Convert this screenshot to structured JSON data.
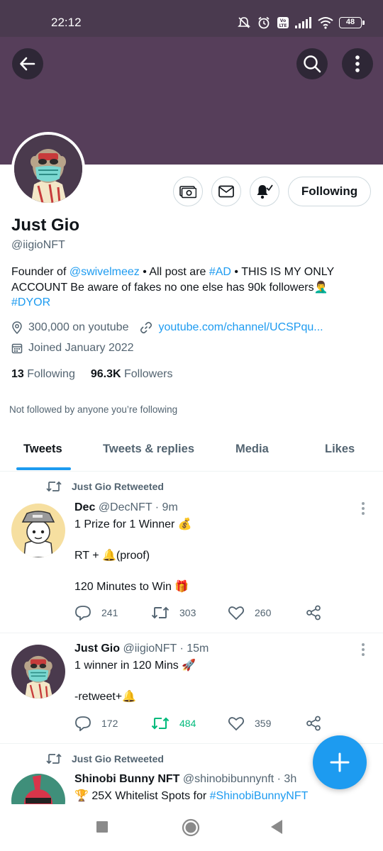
{
  "status": {
    "time": "22:12",
    "battery": "48",
    "net": "Vo LTE"
  },
  "profile": {
    "name": "Just Gio",
    "handle": "@iigioNFT",
    "following_button": "Following",
    "bio": {
      "p1": "Founder of ",
      "mention": "@swivelmeez",
      "p2": " • All post are ",
      "hashtag1": "#AD",
      "p3": " • THIS IS MY ONLY ACCOUNT Be aware of fakes no one else has 90k followers",
      "emoji": "🤦‍♂️",
      "hashtag2": "#DYOR"
    },
    "location": "300,000 on youtube",
    "website": "youtube.com/channel/UCSPqu...",
    "joined": "Joined January 2022",
    "following_count": "13",
    "following_label": "Following",
    "followers_count": "96.3K",
    "followers_label": "Followers",
    "not_followed": "Not followed by anyone you’re following"
  },
  "tabs": [
    "Tweets",
    "Tweets & replies",
    "Media",
    "Likes"
  ],
  "tweets": [
    {
      "retweeted_by": "Just Gio Retweeted",
      "name": "Dec",
      "handle": "@DecNFT",
      "time": "· 9m",
      "line1": "1 Prize for 1 Winner 💰",
      "line2": "RT + 🔔(proof)",
      "line3": "120 Minutes to Win 🎁",
      "replies": "241",
      "retweets": "303",
      "likes": "260"
    },
    {
      "name": "Just Gio",
      "handle": "@iigioNFT",
      "time": "· 15m",
      "line1": "1 winner in 120 Mins 🚀",
      "line2": "-retweet+🔔",
      "replies": "172",
      "retweets": "484",
      "likes": "359"
    },
    {
      "retweeted_by": "Just Gio Retweeted",
      "name": "Shinobi Bunny NFT",
      "handle": "@shinobibunnynft",
      "time": "· 3h",
      "line1_prefix": "🏆 25X Whitelist Spots for ",
      "line1_tag": "#ShinobiBunnyNFT"
    }
  ],
  "colors": {
    "accent": "#1d9bf0",
    "banner": "#563e5a",
    "retweet_active": "#00ba7c"
  }
}
